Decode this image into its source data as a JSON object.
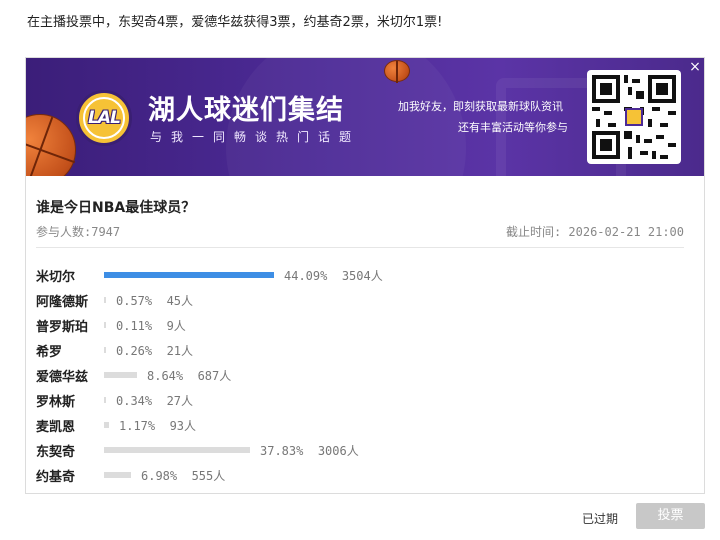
{
  "intro_text": "在主播投票中，东契奇4票，爱德华兹获得3票，约基奇2票，米切尔1票!",
  "banner": {
    "logo_text": "LAL",
    "title": "湖人球迷们集结",
    "subtitle": "与我一同畅谈热门话题",
    "side_line1": "加我好友，即刻获取最新球队资讯",
    "side_line2": "还有丰富活动等你参与",
    "close_label": "×",
    "qr_icon": "qr-code-icon"
  },
  "poll": {
    "question": "谁是今日NBA最佳球员？",
    "participants": "参与人数:7947",
    "deadline": "截止时间: 2026-02-21 21:00",
    "options": [
      {
        "name": "米切尔",
        "percent": "44.09%",
        "votes": "3504人",
        "share": 0.4409,
        "lead": true
      },
      {
        "name": "阿隆德斯",
        "percent": "0.57%",
        "votes": "45人",
        "share": 0.0057,
        "lead": false
      },
      {
        "name": "普罗斯珀",
        "percent": "0.11%",
        "votes": "9人",
        "share": 0.0011,
        "lead": false
      },
      {
        "name": "希罗",
        "percent": "0.26%",
        "votes": "21人",
        "share": 0.0026,
        "lead": false
      },
      {
        "name": "爱德华兹",
        "percent": "8.64%",
        "votes": "687人",
        "share": 0.0864,
        "lead": false
      },
      {
        "name": "罗林斯",
        "percent": "0.34%",
        "votes": "27人",
        "share": 0.0034,
        "lead": false
      },
      {
        "name": "麦凯恩",
        "percent": "1.17%",
        "votes": "93人",
        "share": 0.0117,
        "lead": false
      },
      {
        "name": "东契奇",
        "percent": "37.83%",
        "votes": "3006人",
        "share": 0.3783,
        "lead": false
      },
      {
        "name": "约基奇",
        "percent": "6.98%",
        "votes": "555人",
        "share": 0.0698,
        "lead": false
      }
    ]
  },
  "footer": {
    "status": "已过期",
    "vote_button": "投票"
  },
  "colors": {
    "banner": "#4c2a95",
    "lead_bar": "#3d8ee5",
    "other_bar": "#dcdcdc",
    "logo_gold": "#f6c236"
  }
}
